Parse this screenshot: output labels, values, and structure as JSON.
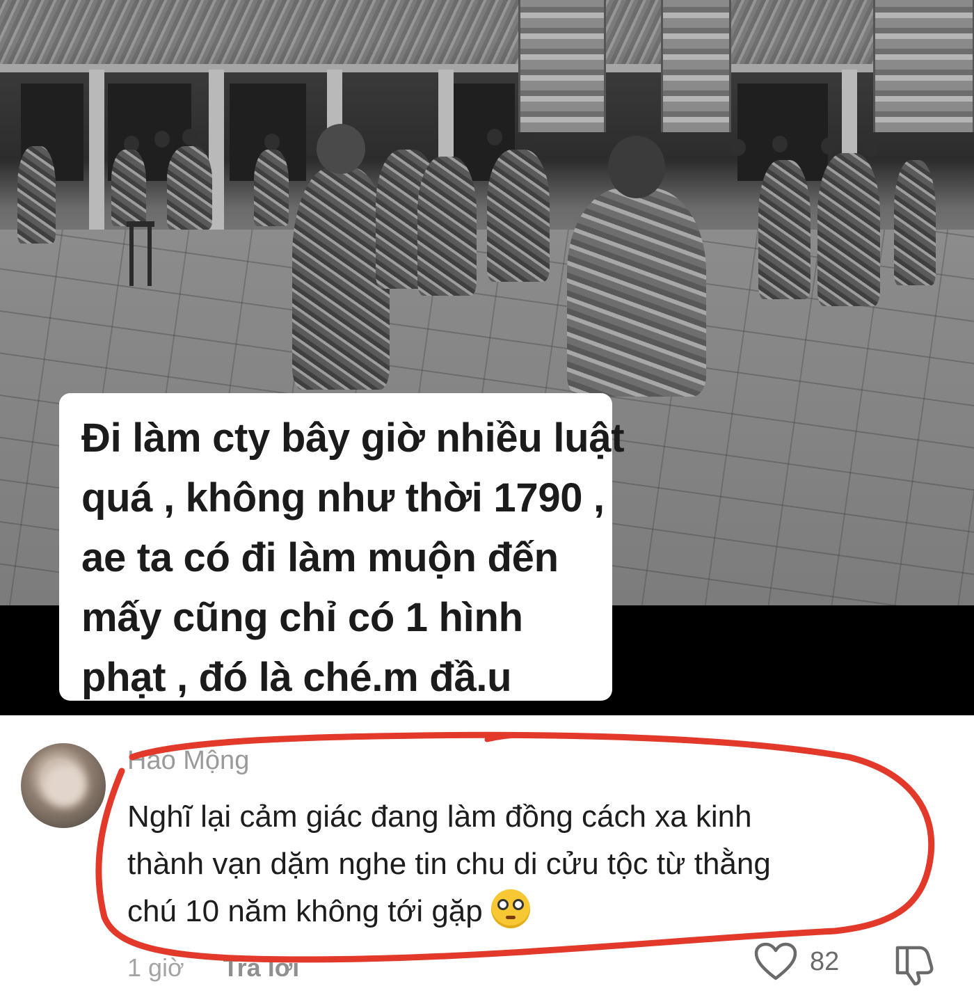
{
  "caption": {
    "lines": [
      "Đi làm cty bây giờ nhiều luật",
      "quá , không như thời 1790 ,",
      "ae ta có đi làm muộn đến",
      "mấy cũng chỉ có 1 hình",
      "phạt , đó là ché.m đầ.u"
    ]
  },
  "comment": {
    "username": "Hảo Mộng",
    "lines": [
      "Nghĩ lại cảm giác đang làm đồng cách xa kinh",
      "thành vạn dặm nghe tin chu di cửu tộc từ thằng",
      "chú 10 năm không tới gặp"
    ],
    "emoji_icon": "flushed-face-emoji",
    "timestamp": "1 giờ",
    "reply_label": "Trả lời",
    "like_count": "82",
    "icons": [
      "heart-icon",
      "dislike-icon"
    ],
    "highlight_color": "#e2392b"
  }
}
